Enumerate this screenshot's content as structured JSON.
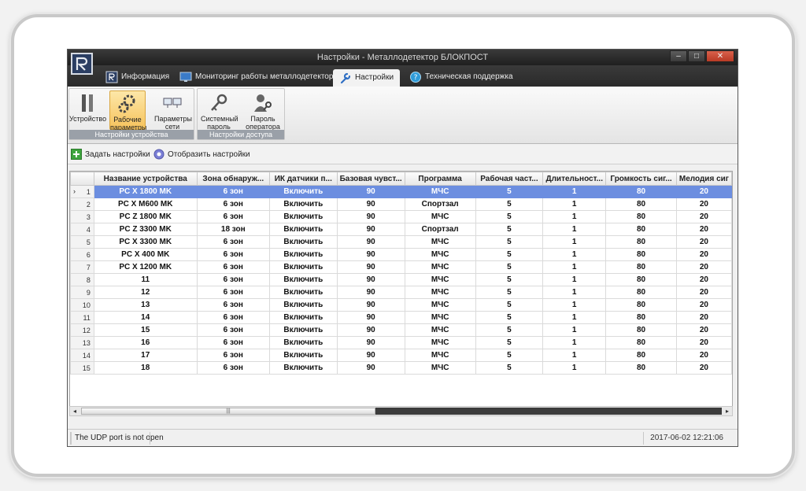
{
  "window": {
    "title": "Настройки - Металлодетектор БЛОКПОСТ",
    "buttons": {
      "minimize": "–",
      "maximize": "□",
      "close": "✕"
    }
  },
  "tabs": [
    {
      "label": "Информация",
      "icon": "info-icon"
    },
    {
      "label": "Мониторинг работы металлодетектора",
      "icon": "monitor-icon"
    },
    {
      "label": "Настройки",
      "icon": "wrench-icon",
      "active": true
    },
    {
      "label": "Техническая поддержка",
      "icon": "support-icon"
    }
  ],
  "ribbon": {
    "groups": [
      {
        "label": "Настройки устройства",
        "buttons": [
          {
            "label": "Устройство",
            "icon": "device-icon"
          },
          {
            "label": "Рабочие параметры",
            "icon": "gears-icon",
            "selected": true
          },
          {
            "label": "Параметры сети",
            "icon": "network-icon"
          }
        ]
      },
      {
        "label": "Настройки доступа",
        "buttons": [
          {
            "label": "Системный пароль",
            "icon": "keys-icon"
          },
          {
            "label": "Пароль оператора",
            "icon": "user-key-icon"
          }
        ]
      }
    ]
  },
  "toolbar": {
    "set_settings": "Задать настройки",
    "show_settings": "Отобразить настройки"
  },
  "grid": {
    "columns": [
      "Название устройства",
      "Зона обнаруж...",
      "ИК датчики п...",
      "Базовая чувст...",
      "Программа",
      "Рабочая част...",
      "Длительност...",
      "Громкость сиг...",
      "Мелодия сиг"
    ],
    "rows": [
      [
        "1",
        "PC X 1800 MK",
        "6 зон",
        "Включить",
        "90",
        "МЧС",
        "5",
        "1",
        "80",
        "20"
      ],
      [
        "2",
        "PC X M600 MK",
        "6 зон",
        "Включить",
        "90",
        "Спортзал",
        "5",
        "1",
        "80",
        "20"
      ],
      [
        "3",
        "PC Z 1800 MK",
        "6 зон",
        "Включить",
        "90",
        "МЧС",
        "5",
        "1",
        "80",
        "20"
      ],
      [
        "4",
        "PC Z 3300 MK",
        "18 зон",
        "Включить",
        "90",
        "Спортзал",
        "5",
        "1",
        "80",
        "20"
      ],
      [
        "5",
        "PC X 3300 MK",
        "6 зон",
        "Включить",
        "90",
        "МЧС",
        "5",
        "1",
        "80",
        "20"
      ],
      [
        "6",
        "PC X 400 MK",
        "6 зон",
        "Включить",
        "90",
        "МЧС",
        "5",
        "1",
        "80",
        "20"
      ],
      [
        "7",
        "PC X 1200 MK",
        "6 зон",
        "Включить",
        "90",
        "МЧС",
        "5",
        "1",
        "80",
        "20"
      ],
      [
        "8",
        "11",
        "6 зон",
        "Включить",
        "90",
        "МЧС",
        "5",
        "1",
        "80",
        "20"
      ],
      [
        "9",
        "12",
        "6 зон",
        "Включить",
        "90",
        "МЧС",
        "5",
        "1",
        "80",
        "20"
      ],
      [
        "10",
        "13",
        "6 зон",
        "Включить",
        "90",
        "МЧС",
        "5",
        "1",
        "80",
        "20"
      ],
      [
        "11",
        "14",
        "6 зон",
        "Включить",
        "90",
        "МЧС",
        "5",
        "1",
        "80",
        "20"
      ],
      [
        "12",
        "15",
        "6 зон",
        "Включить",
        "90",
        "МЧС",
        "5",
        "1",
        "80",
        "20"
      ],
      [
        "13",
        "16",
        "6 зон",
        "Включить",
        "90",
        "МЧС",
        "5",
        "1",
        "80",
        "20"
      ],
      [
        "14",
        "17",
        "6 зон",
        "Включить",
        "90",
        "МЧС",
        "5",
        "1",
        "80",
        "20"
      ],
      [
        "15",
        "18",
        "6 зон",
        "Включить",
        "90",
        "МЧС",
        "5",
        "1",
        "80",
        "20"
      ]
    ],
    "selected_row": 0,
    "current_row_marker": "›"
  },
  "scrollbar": {
    "left_arrow": "◂",
    "right_arrow": "▸",
    "grip": "|||"
  },
  "statusbar": {
    "message": "The UDP port is not open",
    "datetime": "2017-06-02 12:21:06"
  },
  "colors": {
    "selection": "#6c8ee0",
    "titlebar": "#2a2a2a",
    "selected_ribbon": "#f6c35c"
  }
}
